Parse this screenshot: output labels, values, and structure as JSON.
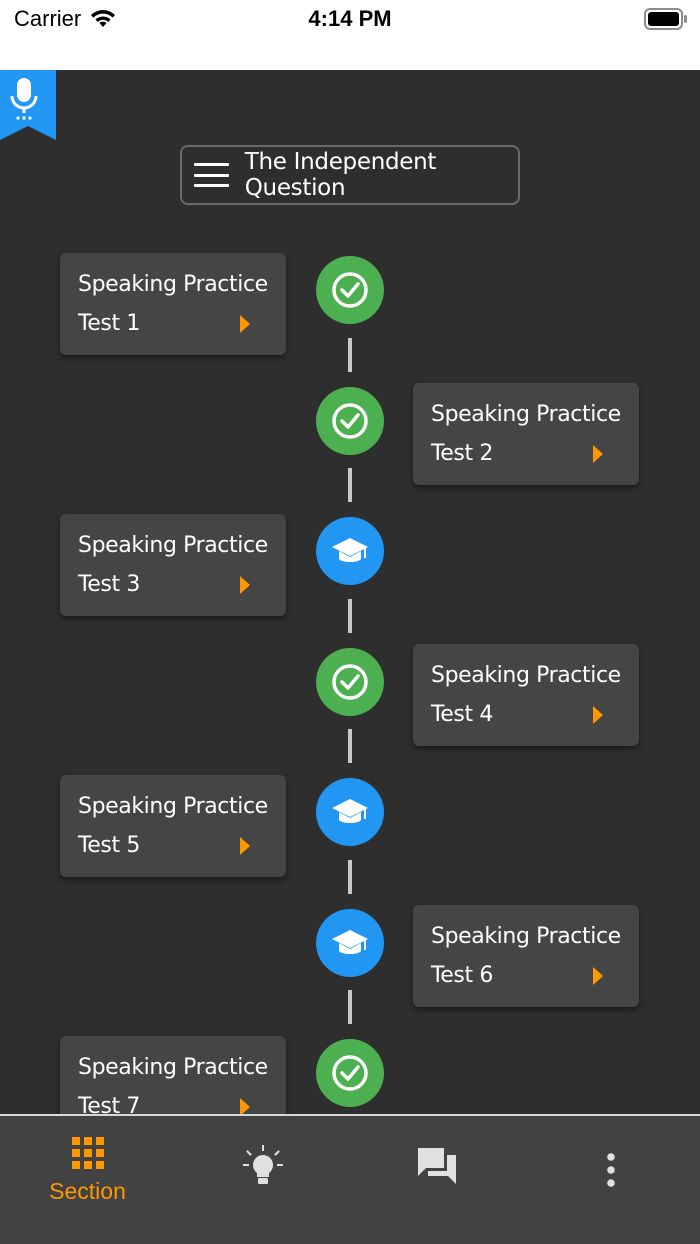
{
  "status_bar": {
    "carrier": "Carrier",
    "time": "4:14 PM"
  },
  "header": {
    "title": "The Independent Question",
    "menu_icon": "hamburger-menu-icon",
    "mic_icon": "microphone-icon"
  },
  "tests": [
    {
      "line1": "Speaking Practice",
      "line2": "Test 1",
      "status": "completed",
      "icon": "check-circle-icon"
    },
    {
      "line1": "Speaking Practice",
      "line2": "Test 2",
      "status": "completed",
      "icon": "check-circle-icon"
    },
    {
      "line1": "Speaking Practice",
      "line2": "Test 3",
      "status": "learning",
      "icon": "graduation-cap-icon"
    },
    {
      "line1": "Speaking Practice",
      "line2": "Test 4",
      "status": "completed",
      "icon": "check-circle-icon"
    },
    {
      "line1": "Speaking Practice",
      "line2": "Test 5",
      "status": "learning",
      "icon": "graduation-cap-icon"
    },
    {
      "line1": "Speaking Practice",
      "line2": "Test 6",
      "status": "learning",
      "icon": "graduation-cap-icon"
    },
    {
      "line1": "Speaking Practice",
      "line2": "Test 7",
      "status": "completed",
      "icon": "check-circle-icon"
    }
  ],
  "bottom_nav": {
    "items": [
      {
        "label": "Section",
        "icon": "grid-icon",
        "active": true
      },
      {
        "label": "",
        "icon": "lightbulb-icon",
        "active": false
      },
      {
        "label": "",
        "icon": "chat-bubbles-icon",
        "active": false
      },
      {
        "label": "",
        "icon": "more-vertical-icon",
        "active": false
      }
    ]
  },
  "colors": {
    "background": "#2e2e2e",
    "card": "#454545",
    "completed": "#4caf50",
    "learning": "#2196f3",
    "accent": "#ff9800",
    "nav_background": "#424242"
  }
}
